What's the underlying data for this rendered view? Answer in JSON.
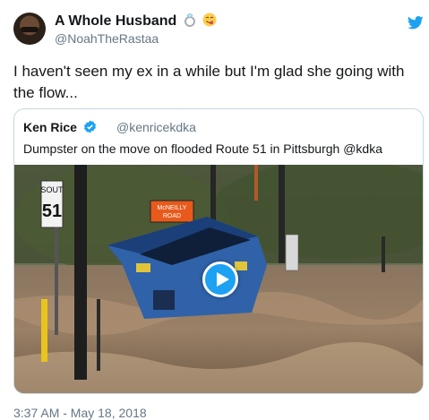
{
  "author": {
    "display_name": "A Whole Husband",
    "handle": "@NoahTheRastaa",
    "name_emoji": [
      "ring-emoji",
      "yum-face-emoji"
    ]
  },
  "tweet": {
    "text": "I haven't seen my ex in a while but I'm glad she going with the flow..."
  },
  "quoted_tweet": {
    "display_name": "Ken Rice",
    "handle": "@kenricekdka",
    "text": "Dumpster on the move on flooded Route 51 in Pittsburgh @kdka",
    "media": {
      "type": "video",
      "sign_route": "SOUT",
      "sign_number": "51",
      "street_sign": [
        "McNEILLY",
        "ROAD"
      ]
    }
  },
  "footer": {
    "timestamp": "3:37 AM - May 18, 2018"
  },
  "colors": {
    "link_blue": "#1da1f2",
    "muted_gray": "#657786",
    "border": "#ccd6dd"
  },
  "icons": [
    "twitter-bird-icon",
    "verified-badge-icon",
    "play-icon"
  ]
}
